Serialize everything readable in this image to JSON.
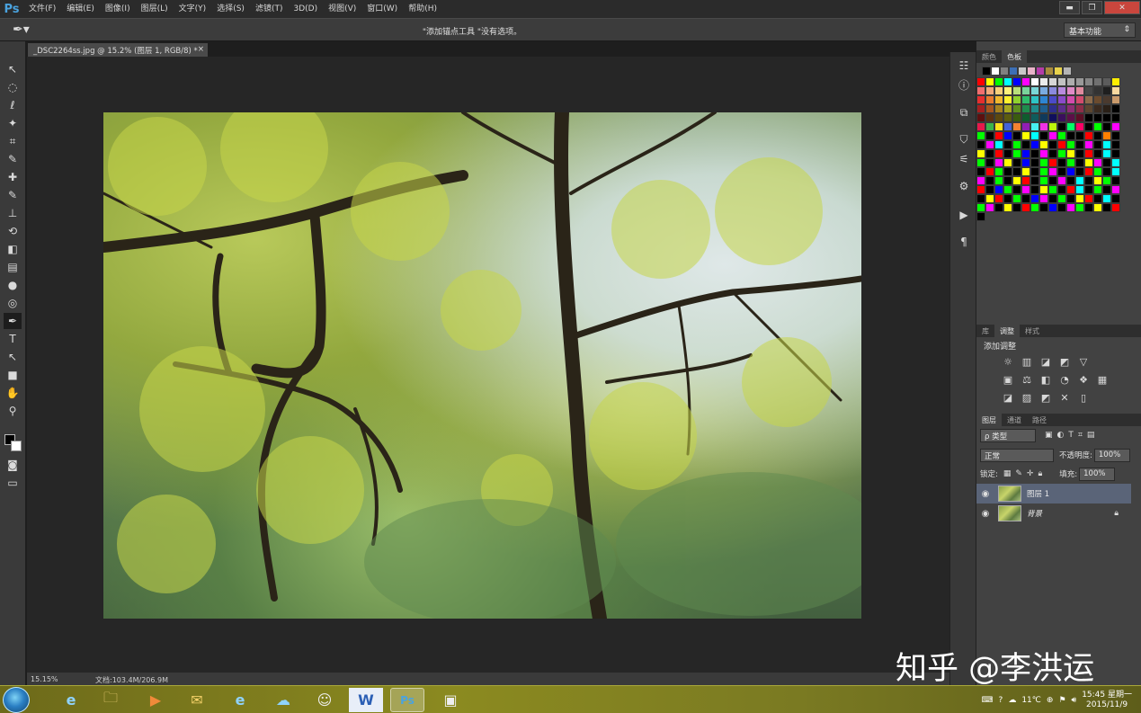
{
  "app": {
    "logo": "Ps"
  },
  "menu": [
    "文件(F)",
    "编辑(E)",
    "图像(I)",
    "图层(L)",
    "文字(Y)",
    "选择(S)",
    "滤镜(T)",
    "3D(D)",
    "视图(V)",
    "窗口(W)",
    "帮助(H)"
  ],
  "options_bar": {
    "message": "\"添加锚点工具 \"没有选项。",
    "workspace": "基本功能"
  },
  "document": {
    "tab_title": "_DSC2264ss.jpg @ 15.2% (图层 1, RGB/8) *",
    "close": "×",
    "zoom": "15.15%",
    "doc_size": "文档:103.4M/206.9M"
  },
  "tools": [
    "↖",
    "◌",
    "ℓ",
    "✦",
    "⌗",
    "✎",
    "✚",
    "✎",
    "⊥",
    "⟲",
    "◧",
    "▤",
    "●",
    "◎",
    "✒",
    "T",
    "↖",
    "■",
    "✋",
    "⚲"
  ],
  "panels": {
    "color_tabs": [
      "颜色",
      "色板"
    ],
    "recent_swatches": [
      "#000000",
      "#ffffff",
      "#808080",
      "#3d6fb5",
      "#c8c8c8",
      "#e9b4c8",
      "#b43ca8",
      "#a88c3c",
      "#e8d24c",
      "#b4b4b4"
    ],
    "swatch_colors": [
      "#ff0000",
      "#ffff00",
      "#00ff00",
      "#00ffff",
      "#0000ff",
      "#ff00ff",
      "#ffffff",
      "#ebebeb",
      "#d6d6d6",
      "#c2c2c2",
      "#adadad",
      "#999999",
      "#858585",
      "#707070",
      "#5c5c5c",
      "#ffee00",
      "#f26e6e",
      "#f2a97a",
      "#f7d07a",
      "#fff27a",
      "#b9e07a",
      "#7ad39b",
      "#7ad6d6",
      "#7aabe0",
      "#8a8ade",
      "#b88ade",
      "#e08ac7",
      "#e08a9e",
      "#474747",
      "#333333",
      "#1f1f1f",
      "#f9d9a0",
      "#e62e2e",
      "#e87a2e",
      "#f0b82e",
      "#fff22e",
      "#8fd22e",
      "#2ebd6b",
      "#2ec4c4",
      "#2e85d2",
      "#4b4bc9",
      "#8a4bc9",
      "#d24bad",
      "#d24b6e",
      "#8c6b4b",
      "#6b4b2e",
      "#4b3a2e",
      "#c99a6b",
      "#a61f1f",
      "#a6561f",
      "#a6821f",
      "#a6a61f",
      "#5f8f1f",
      "#1f8c4d",
      "#1f8c8c",
      "#1f5f8f",
      "#2e2e8c",
      "#5c2e8c",
      "#8c2e73",
      "#8c2e48",
      "#5c4630",
      "#3a2a1f",
      "#2a2017",
      "#000000",
      "#5c0f0f",
      "#5c300f",
      "#5c480f",
      "#5c5c0f",
      "#3a5c0f",
      "#0f5c2e",
      "#0f5c5c",
      "#0f3a5c",
      "#0f0f5c",
      "#3a0f5c",
      "#5c0f48",
      "#5c0f26",
      "#000000",
      "#000000",
      "#000000",
      "#000000",
      "#e6194b",
      "#3cb44b",
      "#ffe119",
      "#4363d8",
      "#f58231",
      "#911eb4",
      "#46f0f0",
      "#f032e6",
      "#bcf60c",
      "#000000",
      "#00ff66",
      "#ff0066",
      "#000000",
      "#00ff00",
      "#000000",
      "#ff00ff",
      "#00ff00",
      "#000000",
      "#ff0000",
      "#0000ff",
      "#000000",
      "#ffff00",
      "#00ffff",
      "#000000",
      "#ff00ff",
      "#00ff00",
      "#000000",
      "#000000",
      "#ff0000",
      "#000000",
      "#ff7f00",
      "#000000",
      "#000000",
      "#ff00ff",
      "#00ffff",
      "#000000",
      "#00ff00",
      "#000000",
      "#0000ff",
      "#ffff00",
      "#000000",
      "#ff0000",
      "#00ff00",
      "#000000",
      "#ff00ff",
      "#000000",
      "#00ffff",
      "#000000",
      "#ffff00",
      "#000000",
      "#ff0000",
      "#000000",
      "#00ff00",
      "#0000ff",
      "#000000",
      "#ff00ff",
      "#000000",
      "#00ff00",
      "#ffff00",
      "#000000",
      "#ff0000",
      "#000000",
      "#00ffff",
      "#000000",
      "#00ff00",
      "#000000",
      "#ff00ff",
      "#ffff00",
      "#000000",
      "#0000ff",
      "#000000",
      "#00ff00",
      "#ff0000",
      "#000000",
      "#00ff00",
      "#000000",
      "#ffff00",
      "#ff00ff",
      "#000000",
      "#00ffff",
      "#000000",
      "#ff0000",
      "#00ff00",
      "#000000",
      "#000000",
      "#ffff00",
      "#000000",
      "#00ff00",
      "#ff00ff",
      "#000000",
      "#0000ff",
      "#000000",
      "#ff0000",
      "#00ff00",
      "#000000",
      "#00ffff",
      "#ff00ff",
      "#000000",
      "#00ff00",
      "#000000",
      "#ffff00",
      "#ff0000",
      "#000000",
      "#00ff00",
      "#000000",
      "#ff00ff",
      "#000000",
      "#00ffff",
      "#000000",
      "#ffff00",
      "#00ff00",
      "#000000",
      "#ff0000",
      "#000000",
      "#0000ff",
      "#00ff00",
      "#000000",
      "#ff00ff",
      "#000000",
      "#ffff00",
      "#00ff00",
      "#000000",
      "#ff0000",
      "#00ffff",
      "#000000",
      "#00ff00",
      "#000000",
      "#ff00ff",
      "#000000",
      "#ffff00",
      "#ff0000",
      "#000000",
      "#00ff00",
      "#000000",
      "#0000ff",
      "#ff00ff",
      "#000000",
      "#00ff00",
      "#000000",
      "#ffff00",
      "#ff0000",
      "#000000",
      "#00ffff",
      "#000000",
      "#00ff00",
      "#ff00ff",
      "#000000",
      "#ffff00",
      "#000000",
      "#ff0000",
      "#00ff00",
      "#000000",
      "#0000ff",
      "#000000",
      "#ff00ff",
      "#00ff00",
      "#000000",
      "#ffff00",
      "#000000",
      "#ff0000",
      "#000000"
    ],
    "adjust_tabs": [
      "库",
      "调整",
      "样式"
    ],
    "adjust_title": "添加调整",
    "adjust_row1": [
      "☼",
      "▥",
      "◪",
      "◩",
      "▽"
    ],
    "adjust_row2": [
      "▣",
      "⚖",
      "◧",
      "◔",
      "❖",
      "▦"
    ],
    "adjust_row3": [
      "◪",
      "▨",
      "◩",
      "✕",
      "▯"
    ],
    "layers_tabs": [
      "图层",
      "通道",
      "路径"
    ],
    "layer_filter": "ρ 类型",
    "blend_mode": "正常",
    "opacity_label": "不透明度:",
    "opacity_value": "100%",
    "lock_label": "锁定:",
    "fill_label": "填充:",
    "fill_value": "100%",
    "layers": [
      {
        "name": "图层 1",
        "selected": true
      },
      {
        "name": "背景",
        "locked": true
      }
    ]
  },
  "watermark": "知乎 @李洪运",
  "taskbar": {
    "icons": [
      "e",
      "🗀",
      "▶",
      "✉",
      "e",
      "☁",
      "☺",
      "W",
      "Ps",
      "▣"
    ],
    "weather": "11℃",
    "time": "15:45 星期一",
    "date": "2015/11/9"
  }
}
